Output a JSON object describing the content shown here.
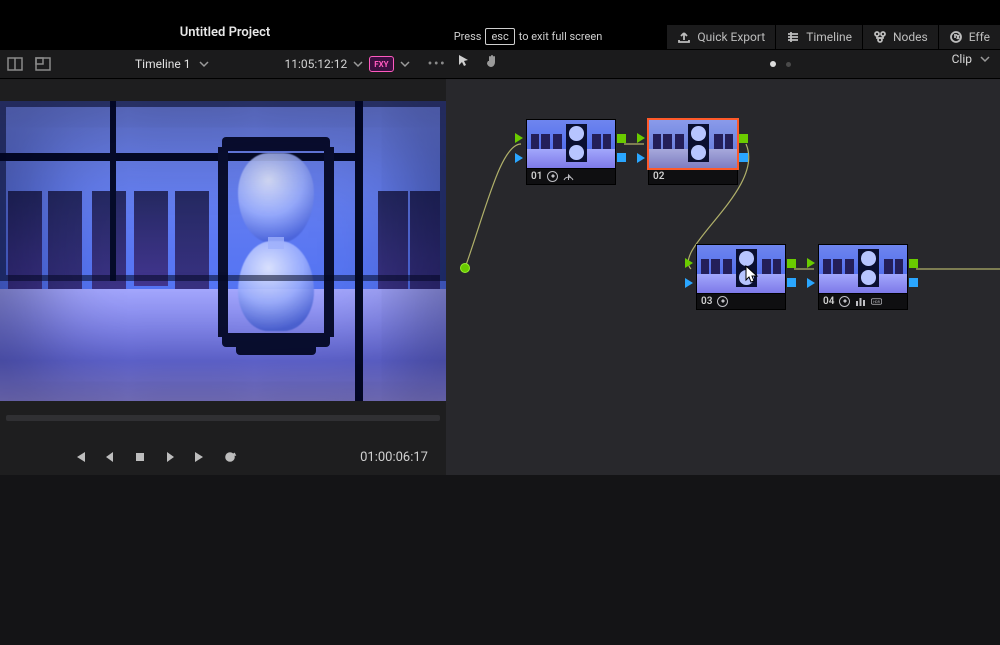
{
  "project_title": "Untitled Project",
  "overlay": {
    "press": "Press",
    "esc": "esc",
    "to_exit": "to exit full screen"
  },
  "top_tabs": {
    "quick_export": "Quick Export",
    "timeline": "Timeline",
    "nodes": "Nodes",
    "effects": "Effe"
  },
  "subbar": {
    "timeline_name": "Timeline 1",
    "timecode_source": "11:05:12:12",
    "bypass_label": "FXY"
  },
  "transport": {
    "current_tc": "01:00:06:17"
  },
  "graph": {
    "clip_label": "Clip",
    "input_handle": "input",
    "nodes": [
      {
        "id": "01",
        "badges": [
          "fx",
          "color-space"
        ]
      },
      {
        "id": "02",
        "badges": []
      },
      {
        "id": "03",
        "badges": [
          "fx"
        ]
      },
      {
        "id": "04",
        "badges": [
          "fx",
          "bars",
          "hdr"
        ]
      }
    ]
  },
  "icons": {
    "export": "export-icon",
    "timeline": "timeline-icon",
    "nodes": "nodes-icon",
    "fx": "fx-icon",
    "arrow_tool": "arrow-tool-icon",
    "hand_tool": "hand-tool-icon",
    "skip_back": "skip-back-icon",
    "step_back": "step-back-icon",
    "stop": "stop-icon",
    "play": "play-icon",
    "skip_fwd": "skip-forward-icon",
    "loop": "loop-icon"
  }
}
